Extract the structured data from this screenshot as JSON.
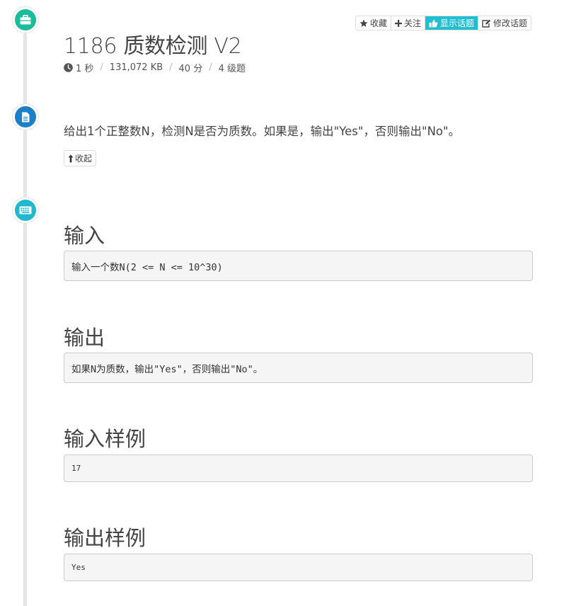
{
  "toolbar": {
    "favorite_label": "收藏",
    "follow_label": "关注",
    "show_topic_label": "显示话题",
    "edit_topic_label": "修改话题"
  },
  "problem": {
    "title": "1186 质数检测 V2",
    "time_limit": "1 秒",
    "memory_limit": "131,072 KB",
    "score": "40 分",
    "level": "4 级题"
  },
  "description": {
    "text": "给出1个正整数N，检测N是否为质数。如果是，输出\"Yes\"，否则输出\"No\"。",
    "collapse_label": "收起"
  },
  "sections": {
    "input_heading": "输入",
    "input_text": "输入一个数N(2 <= N <= 10^30)",
    "output_heading": "输出",
    "output_text": "如果N为质数，输出\"Yes\"，否则输出\"No\"。",
    "sample_input_heading": "输入样例",
    "sample_input_text": "17",
    "sample_output_heading": "输出样例",
    "sample_output_text": "Yes"
  },
  "icons": {
    "briefcase": "briefcase-icon",
    "document": "document-icon",
    "keyboard": "keyboard-icon",
    "clock": "clock-icon"
  },
  "colors": {
    "briefcase_circle": "#1abc9c",
    "document_circle": "#1e7fc6",
    "keyboard_circle": "#1fb8cc",
    "active_button": "#22bfd3"
  }
}
